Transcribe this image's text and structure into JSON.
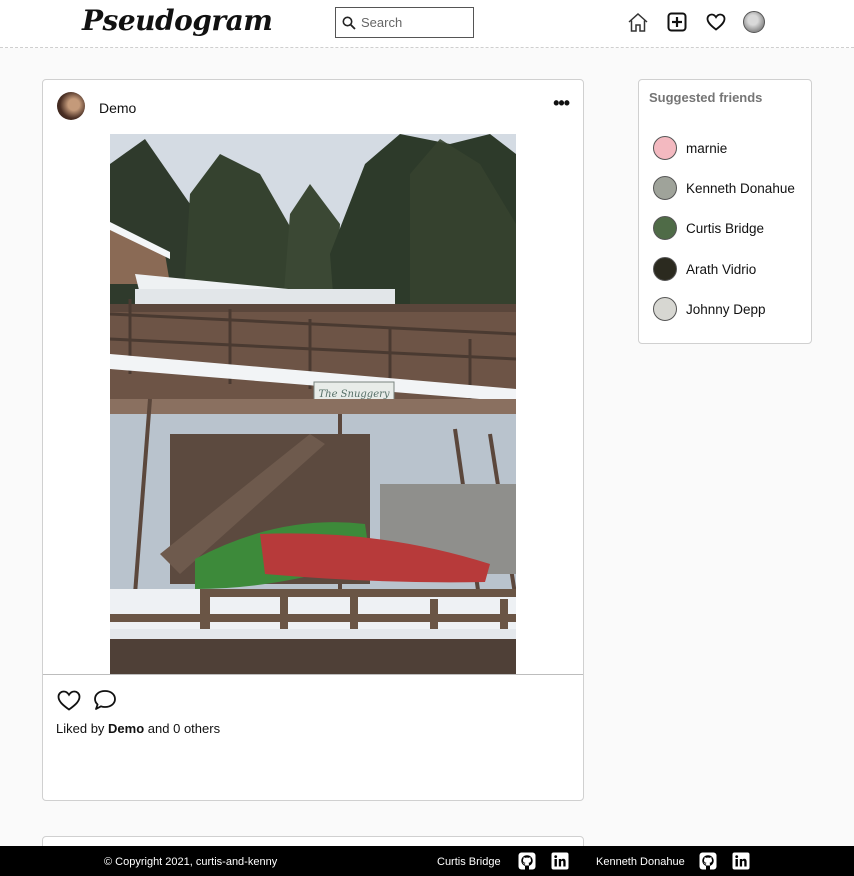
{
  "header": {
    "logo": "Pseudogram",
    "search_placeholder": "Search",
    "icons": [
      "home-icon",
      "new-post-icon",
      "heart-icon",
      "profile-avatar"
    ]
  },
  "post": {
    "username": "Demo",
    "more_label": "•••",
    "likes_prefix": "Liked by",
    "likes_user": "Demo",
    "likes_suffix": "and 0 others",
    "sign_text": "The Snuggery"
  },
  "suggestions": {
    "title": "Suggested friends",
    "friends": [
      {
        "name": "marnie",
        "color": "#f3b9c0"
      },
      {
        "name": "Kenneth Donahue",
        "color": "#9fa39a"
      },
      {
        "name": "Curtis Bridge",
        "color": "#4f6b47"
      },
      {
        "name": "Arath Vidrio",
        "color": "#2b2a1f"
      },
      {
        "name": "Johnny Depp",
        "color": "#d7d7d2"
      }
    ]
  },
  "footer": {
    "copyright": "© Copyright 2021, curtis-and-kenny",
    "author1": "Curtis Bridge",
    "author2": "Kenneth Donahue"
  }
}
